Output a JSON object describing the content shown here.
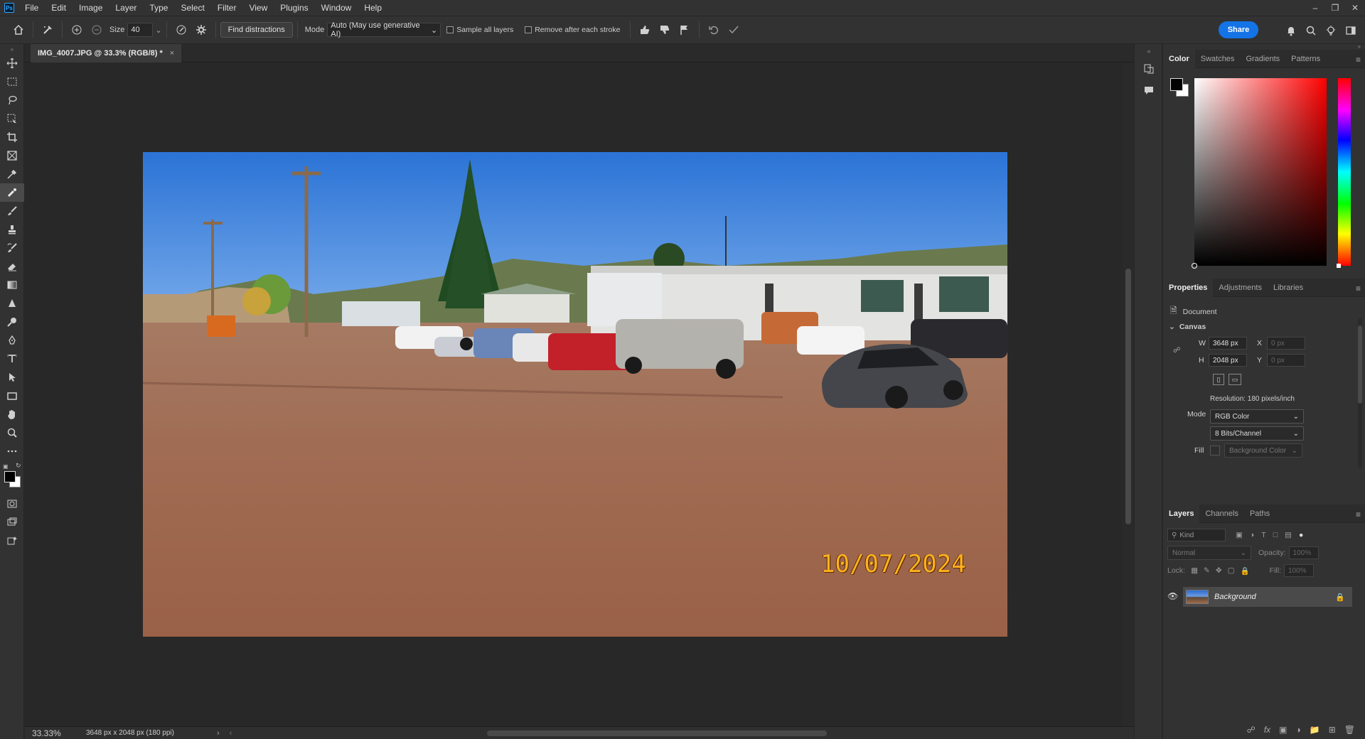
{
  "app": {
    "logo": "Ps",
    "menus": [
      "File",
      "Edit",
      "Image",
      "Layer",
      "Type",
      "Select",
      "Filter",
      "View",
      "Plugins",
      "Window",
      "Help"
    ]
  },
  "options": {
    "size_label": "Size",
    "size_value": "40",
    "find_distractions": "Find distractions",
    "mode_label": "Mode",
    "mode_value": "Auto (May use generative AI)",
    "sample_all_layers": "Sample all layers",
    "remove_after_stroke": "Remove after each stroke",
    "share": "Share"
  },
  "document": {
    "tab_title": "IMG_4007.JPG @ 33.3% (RGB/8) *",
    "date_stamp": "10/07/2024"
  },
  "status": {
    "zoom": "33.33%",
    "doc_info": "3648 px x 2048 px (180 ppi)"
  },
  "color_panel": {
    "tabs": [
      "Color",
      "Swatches",
      "Gradients",
      "Patterns"
    ],
    "fg_color": "#000000",
    "bg_color": "#ffffff"
  },
  "properties": {
    "tabs": [
      "Properties",
      "Adjustments",
      "Libraries"
    ],
    "doc_label": "Document",
    "section": "Canvas",
    "w_label": "W",
    "w_value": "3648 px",
    "h_label": "H",
    "h_value": "2048 px",
    "x_label": "X",
    "x_value": "0 px",
    "y_label": "Y",
    "y_value": "0 px",
    "resolution": "Resolution: 180 pixels/inch",
    "mode_label": "Mode",
    "mode_value": "RGB Color",
    "bits_value": "8 Bits/Channel",
    "fill_label": "Fill",
    "fill_value": "Background Color"
  },
  "layers": {
    "tabs": [
      "Layers",
      "Channels",
      "Paths"
    ],
    "kind_placeholder": "Kind",
    "blend_mode": "Normal",
    "opacity_label": "Opacity:",
    "opacity_value": "100%",
    "lock_label": "Lock:",
    "fill_label": "Fill:",
    "fill_value": "100%",
    "layer_name": "Background"
  }
}
